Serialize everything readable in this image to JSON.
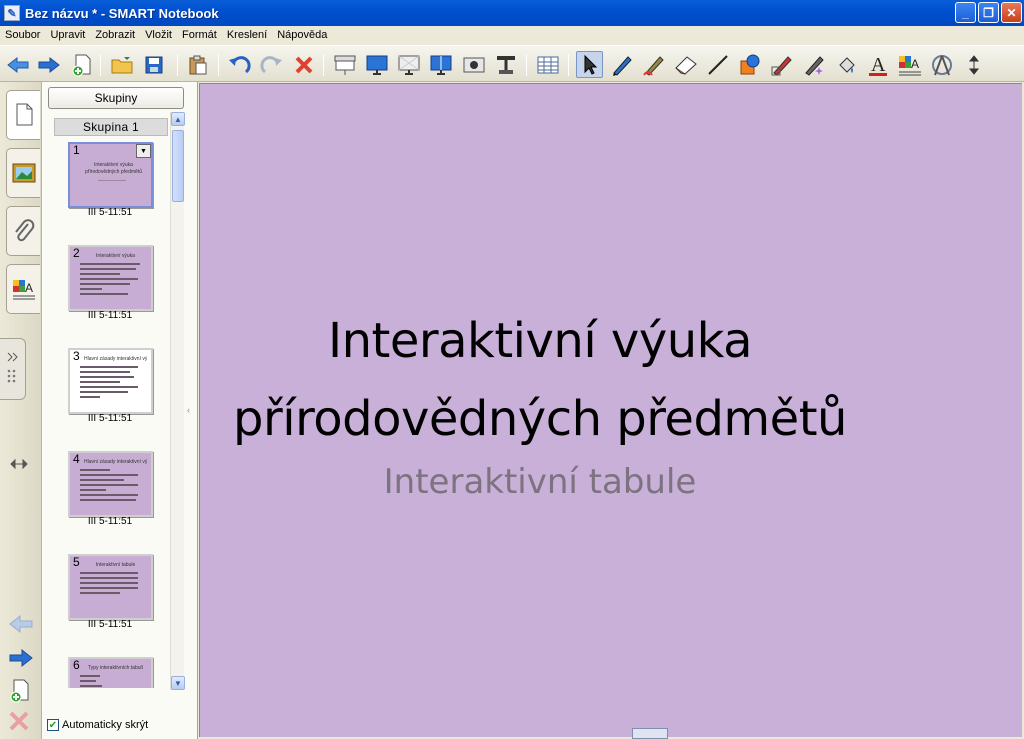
{
  "window": {
    "title": "Bez názvu * - SMART Notebook",
    "controls": [
      "_",
      "❐",
      "✕"
    ]
  },
  "menubar": [
    "Soubor",
    "Upravit",
    "Zobrazit",
    "Vložit",
    "Formát",
    "Kreslení",
    "Nápověda"
  ],
  "toolbar": {
    "icons": [
      "back-arrow-icon",
      "forward-arrow-icon",
      "new-page-icon",
      "open-folder-icon",
      "save-disk-icon",
      "paste-icon",
      "undo-icon",
      "redo-icon",
      "delete-x-icon",
      "screen-shade-icon",
      "full-screen-icon",
      "transparent-background-icon",
      "dual-page-icon",
      "screen-capture-icon",
      "document-camera-icon",
      "table-icon",
      "select-arrow-icon",
      "pen-icon",
      "creative-pen-icon",
      "eraser-icon",
      "line-icon",
      "shapes-icon",
      "shape-recognition-pen-icon",
      "magic-pen-icon",
      "fill-icon",
      "text-icon",
      "properties-icon",
      "measurement-tools-icon",
      "move-toolbar-icon"
    ]
  },
  "side_tabs": [
    "page-sorter-icon",
    "gallery-icon",
    "attachments-icon",
    "properties-icon"
  ],
  "sorter": {
    "groups_label": "Skupiny",
    "group_name": "Skupina 1",
    "pages": [
      {
        "num": "1",
        "date": "III 5-11:51",
        "title": "Interaktivní výuka přírodovědných předmětů"
      },
      {
        "num": "2",
        "date": "III 5-11:51",
        "title": "Interaktivní výuka"
      },
      {
        "num": "3",
        "date": "III 5-11:51",
        "title": "Hlavní zásady interaktivní výuky"
      },
      {
        "num": "4",
        "date": "III 5-11:51",
        "title": "Hlavní zásady interaktivní výuky"
      },
      {
        "num": "5",
        "date": "III 5-11:51",
        "title": "Interaktivní tabule"
      },
      {
        "num": "6",
        "date": "",
        "title": "Typy interaktivních tabulí"
      }
    ],
    "autohide_label": "Automaticky skrýt",
    "autohide_checked": true
  },
  "slide": {
    "title_line1": "Interaktivní výuka",
    "title_line2": "přírodovědných předmětů",
    "subtitle": "Interaktivní tabule"
  },
  "colors": {
    "slide_background": "#c8b0d8",
    "titlebar": "#0050d0"
  }
}
